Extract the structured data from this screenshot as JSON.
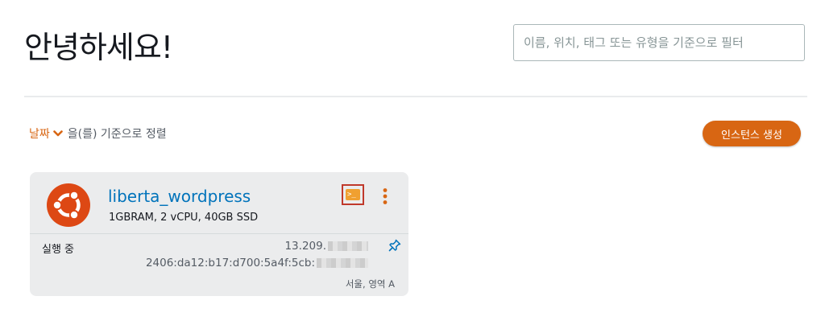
{
  "header": {
    "greeting": "안녕하세요!",
    "search_placeholder": "이름, 위치, 태그 또는 유형을 기준으로 필터"
  },
  "sort": {
    "field_label": "날짜",
    "suffix": "을(를) 기준으로 정렬"
  },
  "actions": {
    "create_instance_label": "인스턴스 생성"
  },
  "instance": {
    "name": "liberta_wordpress",
    "specs": "1GBRAM, 2 vCPU, 40GB SSD",
    "status": "실행 중",
    "ipv4_visible": "13.209.",
    "ipv6_visible": "2406:da12:b17:d700:5a4f:5cb:",
    "region": "서울, 영역 A",
    "os_icon": "ubuntu-logo",
    "connect_icon": "terminal-icon",
    "menu_icon": "kebab-menu-icon",
    "pin_icon": "pin-icon"
  },
  "colors": {
    "accent": "#d86613",
    "link": "#0073bb",
    "card_bg": "#ebeced",
    "ubuntu": "#dd4814",
    "highlight_border": "#c0392b"
  }
}
